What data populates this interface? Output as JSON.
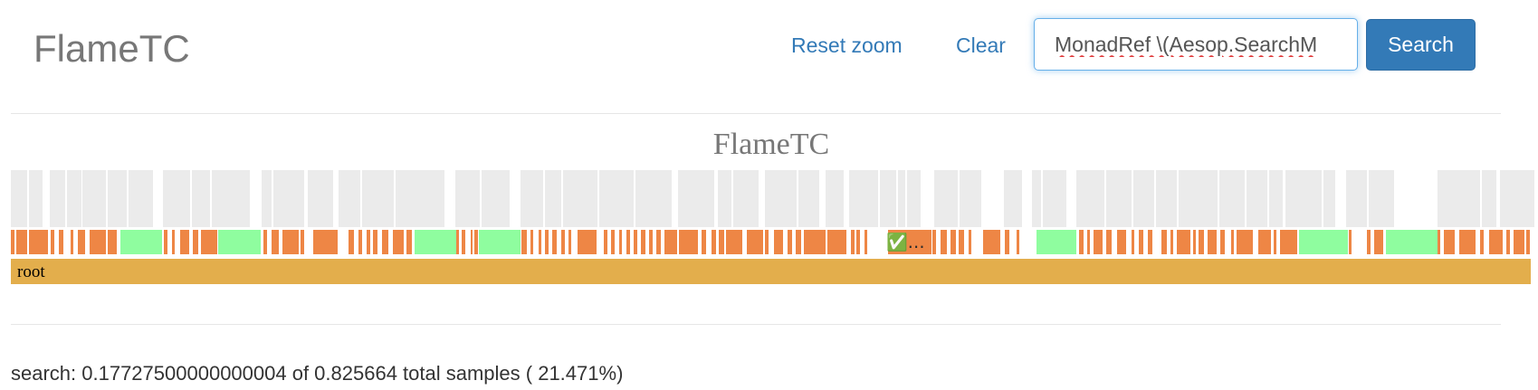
{
  "navbar": {
    "brand": "FlameTC",
    "reset_zoom_label": "Reset zoom",
    "clear_label": "Clear",
    "search_value": "MonadRef \\(Aesop.SearchM",
    "search_button_label": "Search"
  },
  "flamegraph": {
    "title": "FlameTC",
    "root_label": "root",
    "highlight_label": "✅…",
    "colors": {
      "root": "#e3ae4c",
      "frame": "#ee8645",
      "match": "#8ffd9f",
      "faded": "#ebebeb",
      "faded_light": "#f2f2f2"
    }
  },
  "status": {
    "search_summary": "search: 0.17727500000000004 of 0.825664 total samples ( 21.471%)"
  }
}
